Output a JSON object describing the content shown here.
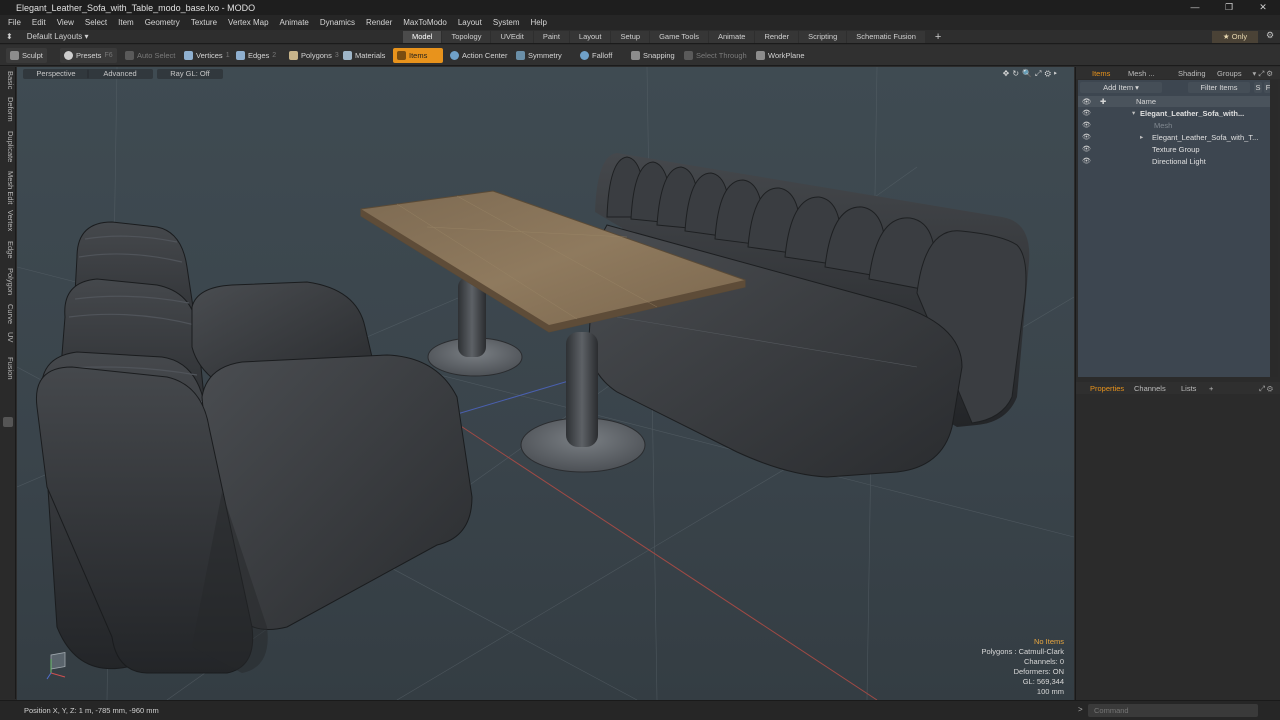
{
  "window": {
    "title": "Elegant_Leather_Sofa_with_Table_modo_base.lxo - MODO",
    "controls": [
      "—",
      "❐",
      "✕"
    ]
  },
  "menu": [
    "File",
    "Edit",
    "View",
    "Select",
    "Item",
    "Geometry",
    "Texture",
    "Vertex Map",
    "Animate",
    "Dynamics",
    "Render",
    "MaxToModo",
    "Layout",
    "System",
    "Help"
  ],
  "layout_bar": {
    "layouts_label": "Default Layouts ▾",
    "tabs": [
      "Model",
      "Topology",
      "UVEdit",
      "Paint",
      "Layout",
      "Setup",
      "Game Tools",
      "Animate",
      "Render",
      "Scripting",
      "Schematic Fusion"
    ],
    "active_tab": "Model",
    "add_tab": "+",
    "only_label": "Only"
  },
  "toolbar": {
    "sculpt": "Sculpt",
    "presets": "Presets",
    "presets_key": "F6",
    "auto_select": "Auto Select",
    "vertices": "Vertices",
    "vertices_key": "1",
    "edges": "Edges",
    "edges_key": "2",
    "polygons": "Polygons",
    "polygons_key": "3",
    "materials": "Materials",
    "items": "Items",
    "action_center": "Action Center",
    "symmetry": "Symmetry",
    "falloff": "Falloff",
    "snapping": "Snapping",
    "select_through": "Select Through",
    "workplane": "WorkPlane"
  },
  "left_tabs": [
    "Basic",
    "Deform",
    "Duplicate",
    "Mesh Edit",
    "Vertex",
    "Edge",
    "Polygon",
    "Curve",
    "UV",
    "Fusion"
  ],
  "viewport": {
    "view_mode": "Perspective",
    "shading": "Advanced",
    "raygl": "Ray GL: Off",
    "info": {
      "no_items": "No Items",
      "polygons": "Polygons : Catmull-Clark",
      "channels": "Channels: 0",
      "deformers": "Deformers: ON",
      "gl": "GL: 569,344",
      "scale": "100 mm"
    }
  },
  "status": {
    "position": "Position X, Y, Z:   1 m, -785 mm, -960 mm",
    "command_placeholder": "Command"
  },
  "items_panel": {
    "tabs": [
      "Items",
      "Mesh ...",
      "Shading",
      "Groups"
    ],
    "active_tab": "Items",
    "add_item": "Add Item",
    "filter_items": "Filter Items",
    "btn_s": "S",
    "btn_f": "F",
    "column_name": "Name",
    "tree": [
      {
        "label": "Elegant_Leather_Sofa_with...",
        "indent": 0,
        "bold": true,
        "expanded": true
      },
      {
        "label": "Mesh",
        "indent": 1,
        "dim": true
      },
      {
        "label": "Elegant_Leather_Sofa_with_T...",
        "indent": 1,
        "collapsed": true
      },
      {
        "label": "Texture Group",
        "indent": 1
      },
      {
        "label": "Directional Light",
        "indent": 1
      }
    ]
  },
  "properties_panel": {
    "tabs": [
      "Properties",
      "Channels",
      "Lists"
    ],
    "active_tab": "Properties",
    "add": "+"
  },
  "colors": {
    "accent": "#e8931c",
    "viewport_bg": "#3d484f",
    "leather": "#2e3033",
    "wood": "#8a7356"
  }
}
